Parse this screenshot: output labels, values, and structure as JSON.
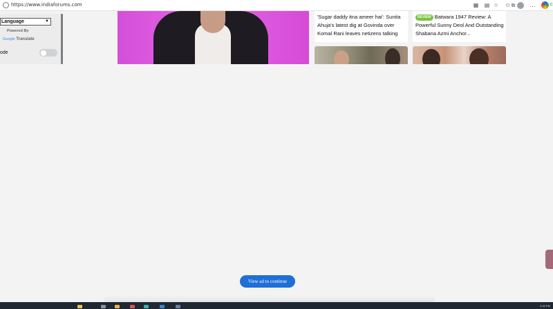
{
  "browser": {
    "url": "https://www.indiaforums.com"
  },
  "translate_widget": {
    "language_label": "Language",
    "powered_by": "Powered By",
    "google_label": "Google",
    "translate_label": "Translate",
    "mode_label": "ode"
  },
  "news": [
    {
      "title": "'Sugar daddy itna ameer hai': Sunita Ahuja's latest dig at Govinda over Komal Rani leaves netizens talking",
      "badge": ""
    },
    {
      "title": "Batwara 1947 Review: A Powerful Sunny Deol And Outstanding Shabana Azmi Anchor...",
      "badge": "REVIEW"
    }
  ],
  "cta": {
    "label": "View ad to continue"
  },
  "taskbar": {
    "time": "2:49 PM"
  },
  "colors": {
    "cta": "#1f6fd6",
    "badge": "#7cc243",
    "hero": "#de5ce0"
  }
}
